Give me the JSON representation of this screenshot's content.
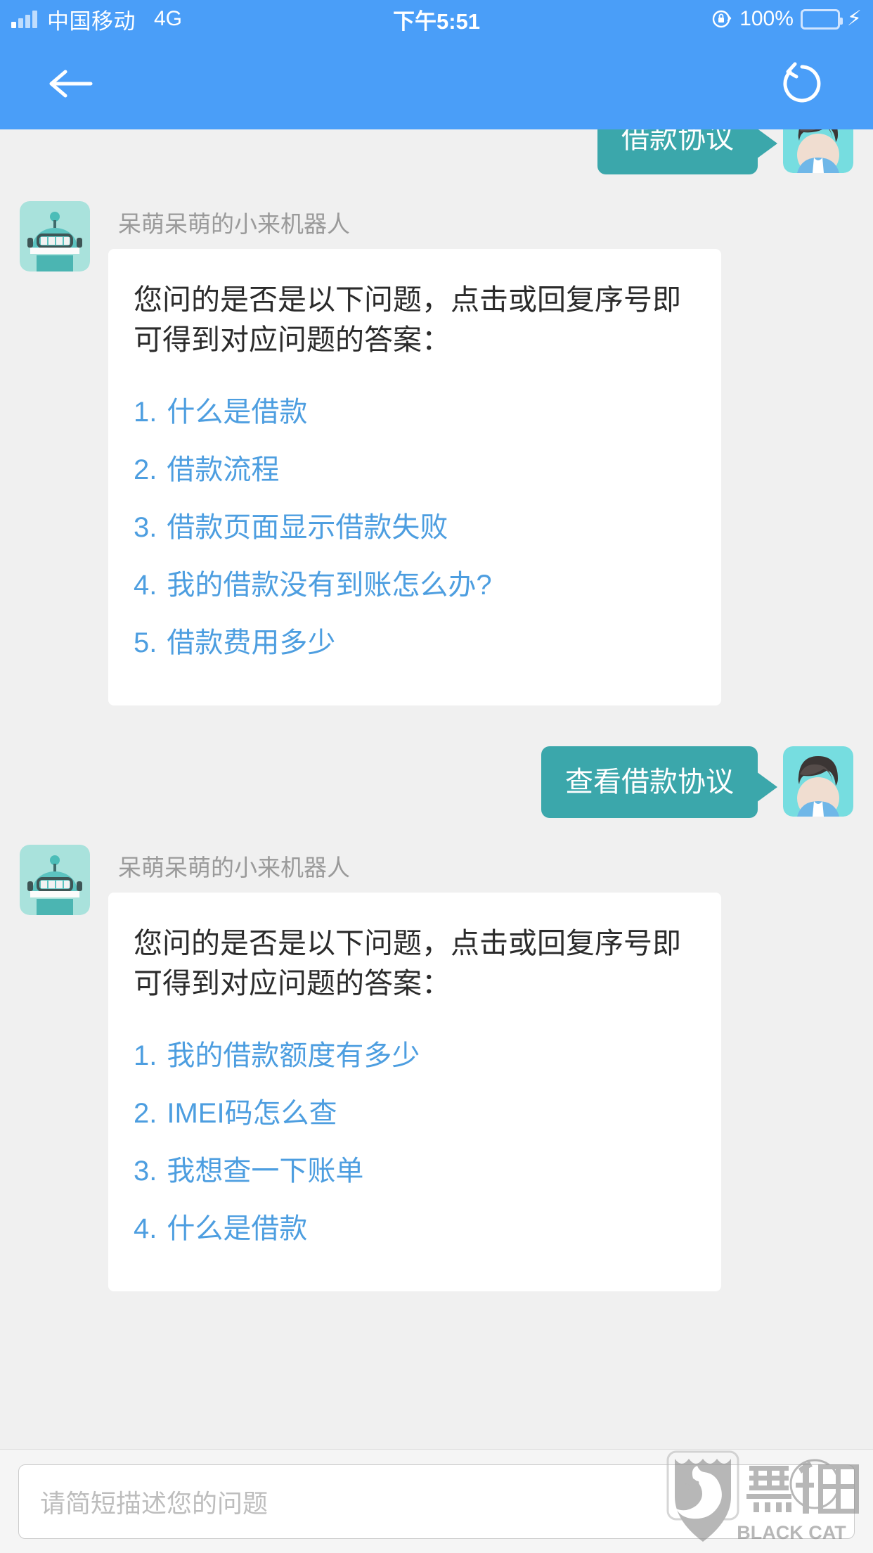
{
  "statusbar": {
    "carrier": "中国移动",
    "network": "4G",
    "time": "下午5:51",
    "battery_percent": "100%",
    "rotation_lock_icon": "rotation-lock-icon",
    "battery_icon": "battery-icon",
    "charging_icon": "lightning-bolt-icon",
    "signal_icon": "signal-bars-icon"
  },
  "navbar": {
    "back_icon": "back-arrow-icon",
    "refresh_icon": "refresh-icon"
  },
  "chat": {
    "bot_name": "呆萌呆萌的小来机器人",
    "messages": [
      {
        "side": "out",
        "text": "借款协议",
        "avatar": "user-avatar"
      },
      {
        "side": "in",
        "name": "呆萌呆萌的小来机器人",
        "avatar": "robot-avatar",
        "intro": "您问的是否是以下问题，点击或回复序号即可得到对应问题的答案：",
        "options": [
          {
            "num": "1.",
            "label": "什么是借款"
          },
          {
            "num": "2.",
            "label": "借款流程"
          },
          {
            "num": "3.",
            "label": "借款页面显示借款失败"
          },
          {
            "num": "4.",
            "label": "我的借款没有到账怎么办?"
          },
          {
            "num": "5.",
            "label": "借款费用多少"
          }
        ]
      },
      {
        "side": "out",
        "text": "查看借款协议",
        "avatar": "user-avatar"
      },
      {
        "side": "in",
        "name": "呆萌呆萌的小来机器人",
        "avatar": "robot-avatar",
        "intro": "您问的是否是以下问题，点击或回复序号即可得到对应问题的答案：",
        "options": [
          {
            "num": "1.",
            "label": "我的借款额度有多少"
          },
          {
            "num": "2.",
            "label": "IMEI码怎么查"
          },
          {
            "num": "3.",
            "label": "我想查一下账单"
          },
          {
            "num": "4.",
            "label": "什么是借款"
          }
        ]
      }
    ]
  },
  "input": {
    "placeholder": "请简短描述您的问题",
    "value": ""
  },
  "watermark": {
    "brand_cn": "黑猫",
    "brand_en": "BLACK CAT",
    "icon": "black-cat-shield-icon"
  },
  "colors": {
    "header_blue": "#4a9ef8",
    "bubble_teal": "#3ba7ab",
    "link_blue": "#4d9ee0",
    "chat_bg": "#f0f0f0",
    "battery_green": "#7ede6b"
  }
}
